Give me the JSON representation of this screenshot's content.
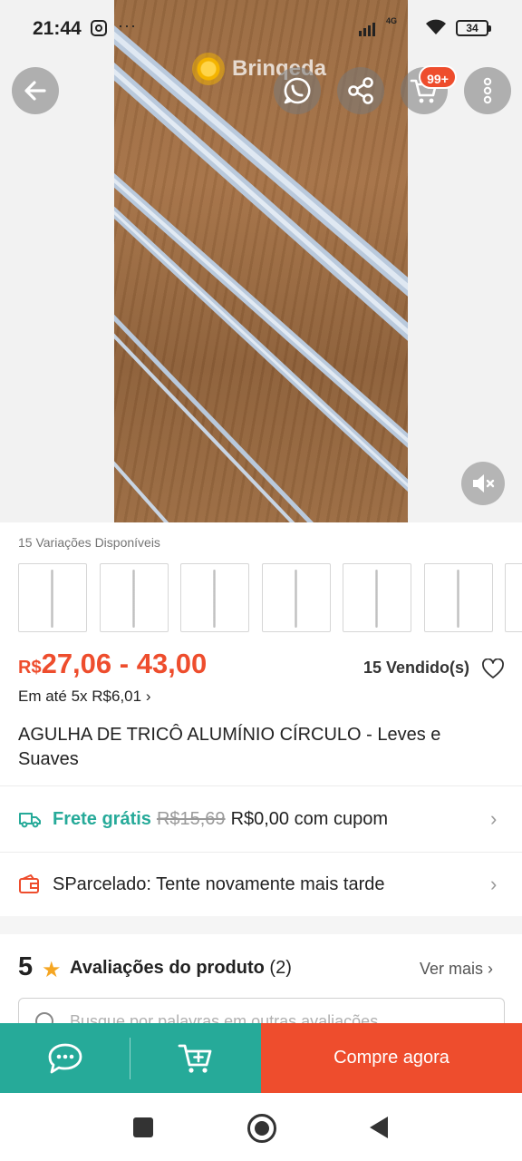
{
  "status_bar": {
    "time": "21:44",
    "overflow": "···",
    "network": "4G",
    "battery": "34"
  },
  "header": {
    "brand": "Brinqeda",
    "cart_badge": "99+",
    "icons": [
      "back-arrow-icon",
      "whatsapp-icon",
      "share-icon",
      "cart-icon",
      "more-vertical-icon",
      "mute-icon"
    ]
  },
  "product": {
    "variations_label": "15 Variações Disponíveis",
    "price_currency": "R$",
    "price_range": "27,06 - 43,00",
    "sold": "15 Vendido(s)",
    "installments": "Em até 5x R$6,01",
    "title": "AGULHA DE TRICÔ ALUMÍNIO CÍRCULO - Leves e Suaves"
  },
  "shipping": {
    "free_label": "Frete grátis",
    "old_price": "R$15,69",
    "new_price": "R$0,00 com cupom"
  },
  "installment_row": {
    "text": "SParcelado: Tente novamente mais tarde"
  },
  "reviews": {
    "rating": "5",
    "title": "Avaliações do produto",
    "count": "(2)",
    "see_more": "Ver mais",
    "search_placeholder": "Busque por palavras em outras avaliações"
  },
  "action_bar": {
    "buy_label": "Compre agora"
  },
  "colors": {
    "accent": "#ee4d2d",
    "teal": "#26aa99"
  }
}
